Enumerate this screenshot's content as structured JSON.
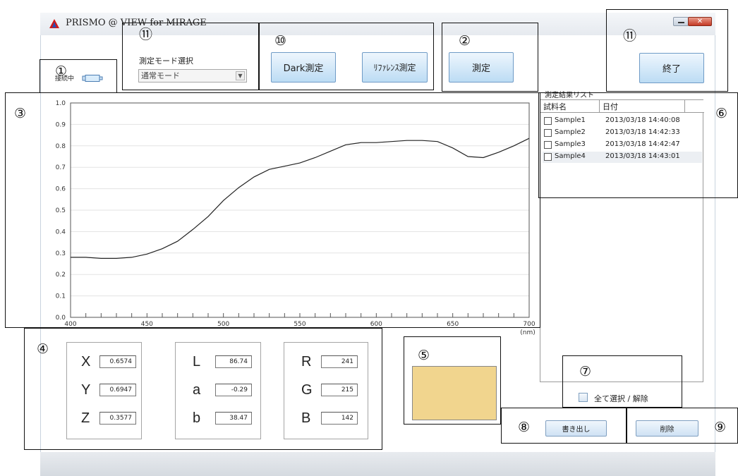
{
  "window": {
    "title": "PRISMO @ VIEW for MIRAGE",
    "close_glyph": "✕",
    "icons": [
      "logo-icon",
      "minimize-icon",
      "close-icon"
    ]
  },
  "connection": {
    "label": "接続中",
    "icon": "connector-icon"
  },
  "mode": {
    "label": "測定モード選択",
    "selected": "通常モード",
    "arrow": "▼"
  },
  "buttons": {
    "dark": "Dark測定",
    "reference": "ﾘﾌｧﾚﾝｽ測定",
    "measure": "測定",
    "exit": "終了",
    "export": "書き出し",
    "delete": "削除"
  },
  "annotations": {
    "n1": "①",
    "n2": "②",
    "n3": "③",
    "n4": "④",
    "n5": "⑤",
    "n6": "⑥",
    "n7": "⑦",
    "n8": "⑧",
    "n9": "⑨",
    "n10": "⑩",
    "n11a": "⑪",
    "n11b": "⑪"
  },
  "chart_data": {
    "type": "line",
    "xlabel": "(nm)",
    "ylabel": "",
    "xlim": [
      400,
      700
    ],
    "ylim": [
      0.0,
      1.0
    ],
    "xticks": [
      "400",
      "450",
      "500",
      "550",
      "600",
      "650",
      "700"
    ],
    "yticks": [
      "0.0",
      "0.1",
      "0.2",
      "0.3",
      "0.4",
      "0.5",
      "0.6",
      "0.7",
      "0.8",
      "0.9",
      "1.0"
    ],
    "grid": "horizontal",
    "series": [
      {
        "x": [
          400,
          410,
          420,
          430,
          440,
          450,
          460,
          470,
          480,
          490,
          500,
          510,
          520,
          530,
          540,
          550,
          560,
          570,
          580,
          590,
          600,
          610,
          620,
          630,
          640,
          650,
          660,
          670,
          680,
          690,
          700
        ],
        "values": [
          0.28,
          0.28,
          0.275,
          0.275,
          0.28,
          0.295,
          0.32,
          0.355,
          0.41,
          0.47,
          0.545,
          0.605,
          0.655,
          0.69,
          0.705,
          0.72,
          0.745,
          0.775,
          0.805,
          0.815,
          0.815,
          0.82,
          0.825,
          0.825,
          0.82,
          0.79,
          0.75,
          0.745,
          0.77,
          0.8,
          0.835
        ]
      }
    ]
  },
  "results": {
    "title": "測定結果リスト",
    "columns": [
      "試料名",
      "日付"
    ],
    "rows": [
      {
        "name": "Sample1",
        "date": "2013/03/18 14:40:08"
      },
      {
        "name": "Sample2",
        "date": "2013/03/18 14:42:33"
      },
      {
        "name": "Sample3",
        "date": "2013/03/18 14:42:47"
      },
      {
        "name": "Sample4",
        "date": "2013/03/18 14:43:01"
      }
    ],
    "select_all": "全て選択 / 解除"
  },
  "values": {
    "xyz": [
      {
        "label": "X",
        "value": "0.6574"
      },
      {
        "label": "Y",
        "value": "0.6947"
      },
      {
        "label": "Z",
        "value": "0.3577"
      }
    ],
    "lab": [
      {
        "label": "L",
        "value": "86.74"
      },
      {
        "label": "a",
        "value": "-0.29"
      },
      {
        "label": "b",
        "value": "38.47"
      }
    ],
    "rgb": [
      {
        "label": "R",
        "value": "241"
      },
      {
        "label": "G",
        "value": "215"
      },
      {
        "label": "B",
        "value": "142"
      }
    ]
  },
  "swatch_color": "#f1d58e"
}
